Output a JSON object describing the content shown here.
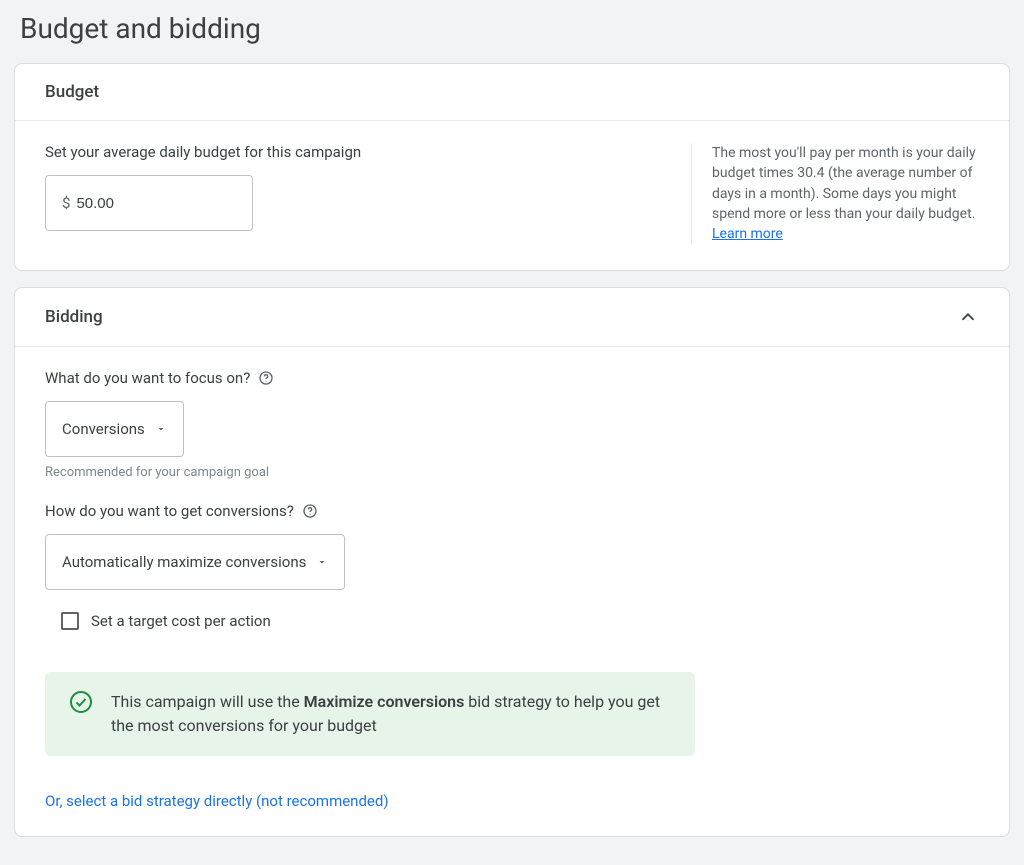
{
  "page": {
    "title": "Budget and bidding"
  },
  "budget": {
    "card_title": "Budget",
    "label": "Set your average daily budget for this campaign",
    "currency_symbol": "$",
    "value": "50.00",
    "helper": "The most you'll pay per month is your daily budget times 30.4 (the average number of days in a month). Some days you might spend more or less than your daily budget. ",
    "learn_more": "Learn more"
  },
  "bidding": {
    "card_title": "Bidding",
    "focus_label": "What do you want to focus on?",
    "focus_value": "Conversions",
    "focus_helper": "Recommended for your campaign goal",
    "how_label": "How do you want to get conversions?",
    "how_value": "Automatically maximize conversions",
    "checkbox_label": "Set a target cost per action",
    "banner_prefix": "This campaign will use the ",
    "banner_bold": "Maximize conversions",
    "banner_suffix": " bid strategy to help you get the most conversions for your budget",
    "alt_link": "Or, select a bid strategy directly (not recommended)"
  }
}
